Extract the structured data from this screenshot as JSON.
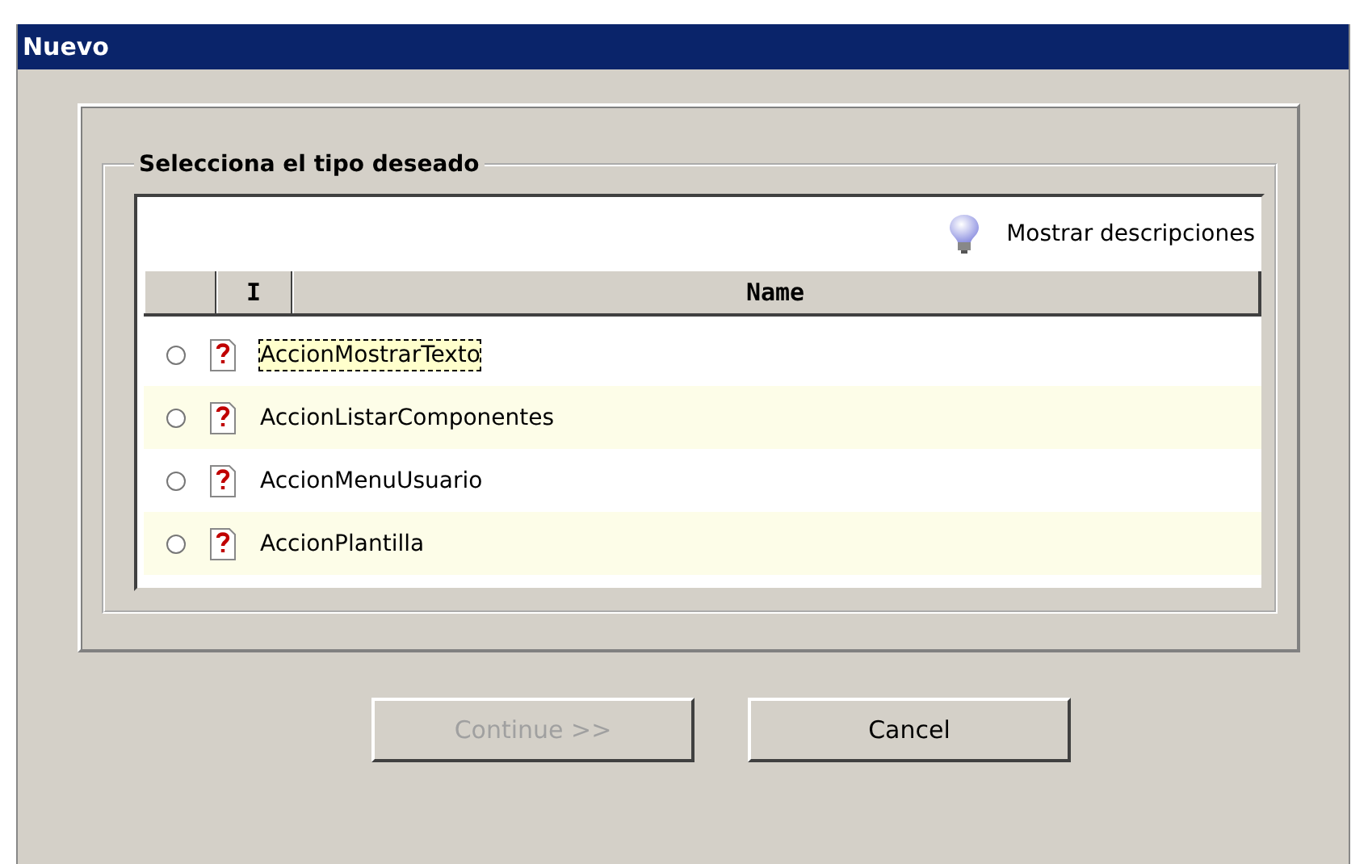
{
  "window": {
    "title": "Nuevo"
  },
  "group": {
    "legend": "Selecciona el tipo deseado"
  },
  "toolbar": {
    "label": "Mostrar descripciones"
  },
  "table": {
    "columns": [
      "I",
      "Name"
    ],
    "rows": [
      {
        "name": "AccionMostrarTexto",
        "selected": false,
        "focused": true
      },
      {
        "name": "AccionListarComponentes",
        "selected": false,
        "focused": false
      },
      {
        "name": "AccionMenuUsuario",
        "selected": false,
        "focused": false
      },
      {
        "name": "AccionPlantilla",
        "selected": false,
        "focused": false
      }
    ]
  },
  "buttons": [
    {
      "label": "Continue >>",
      "disabled": true
    },
    {
      "label": "Cancel",
      "disabled": false
    }
  ]
}
